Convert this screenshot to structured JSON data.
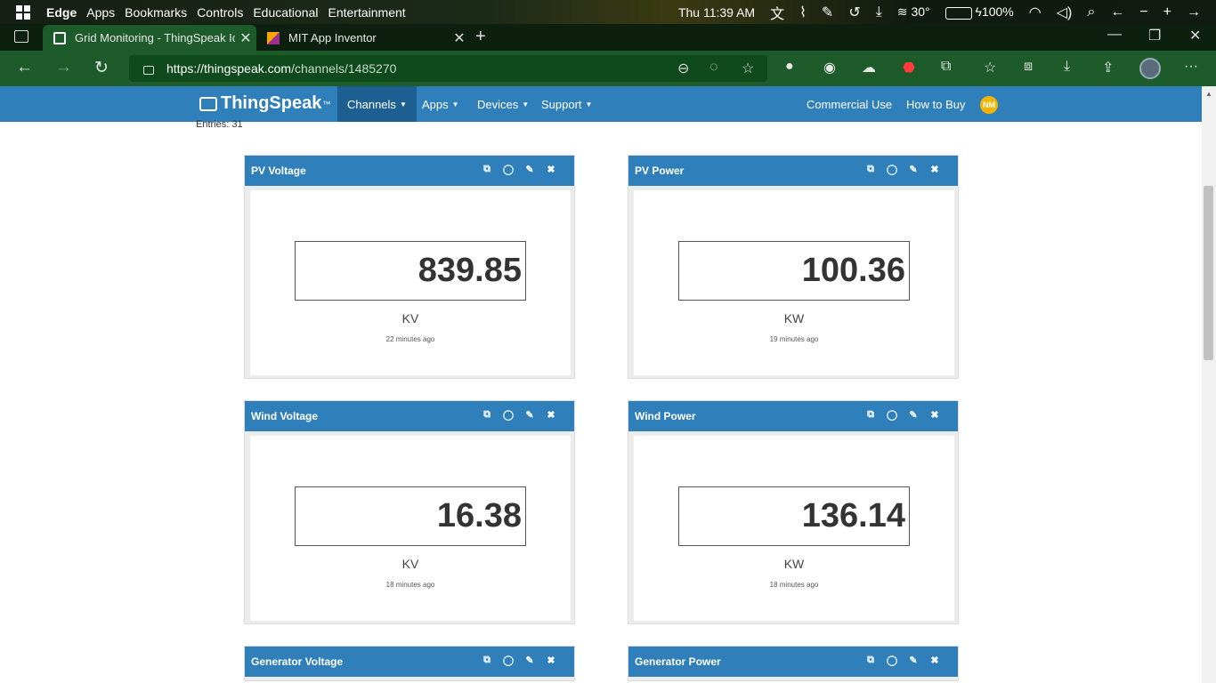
{
  "system": {
    "menu": [
      "Edge",
      "Apps",
      "Bookmarks",
      "Controls",
      "Educational",
      "Entertainment"
    ],
    "datetime": "Thu 11:39 AM",
    "temperature": "30°",
    "battery": "100%"
  },
  "tabs": [
    {
      "title": "Grid Monitoring - ThingSpeak Io",
      "active": true
    },
    {
      "title": "MIT App Inventor",
      "active": false
    }
  ],
  "address": {
    "host": "https://thingspeak.com",
    "path": "/channels/1485270"
  },
  "thingspeak": {
    "logo": "ThingSpeak",
    "trademark": "™",
    "menu": [
      "Channels",
      "Apps",
      "Devices",
      "Support"
    ],
    "right_links": [
      "Commercial Use",
      "How to Buy"
    ],
    "user_initials": "NM"
  },
  "entries_text": "Entries: 31",
  "widgets": [
    {
      "title": "PV Voltage",
      "value": "839.85",
      "unit": "KV",
      "updated": "22 minutes ago"
    },
    {
      "title": "PV Power",
      "value": "100.36",
      "unit": "KW",
      "updated": "19 minutes ago"
    },
    {
      "title": "Wind Voltage",
      "value": "16.38",
      "unit": "KV",
      "updated": "18 minutes ago"
    },
    {
      "title": "Wind Power",
      "value": "136.14",
      "unit": "KW",
      "updated": "18 minutes ago"
    },
    {
      "title": "Generator Voltage"
    },
    {
      "title": "Generator Power"
    }
  ],
  "colors": {
    "thingspeak_blue": "#2f7fba",
    "browser_green": "#1d5b2a",
    "badge_yellow": "#f5b400"
  }
}
